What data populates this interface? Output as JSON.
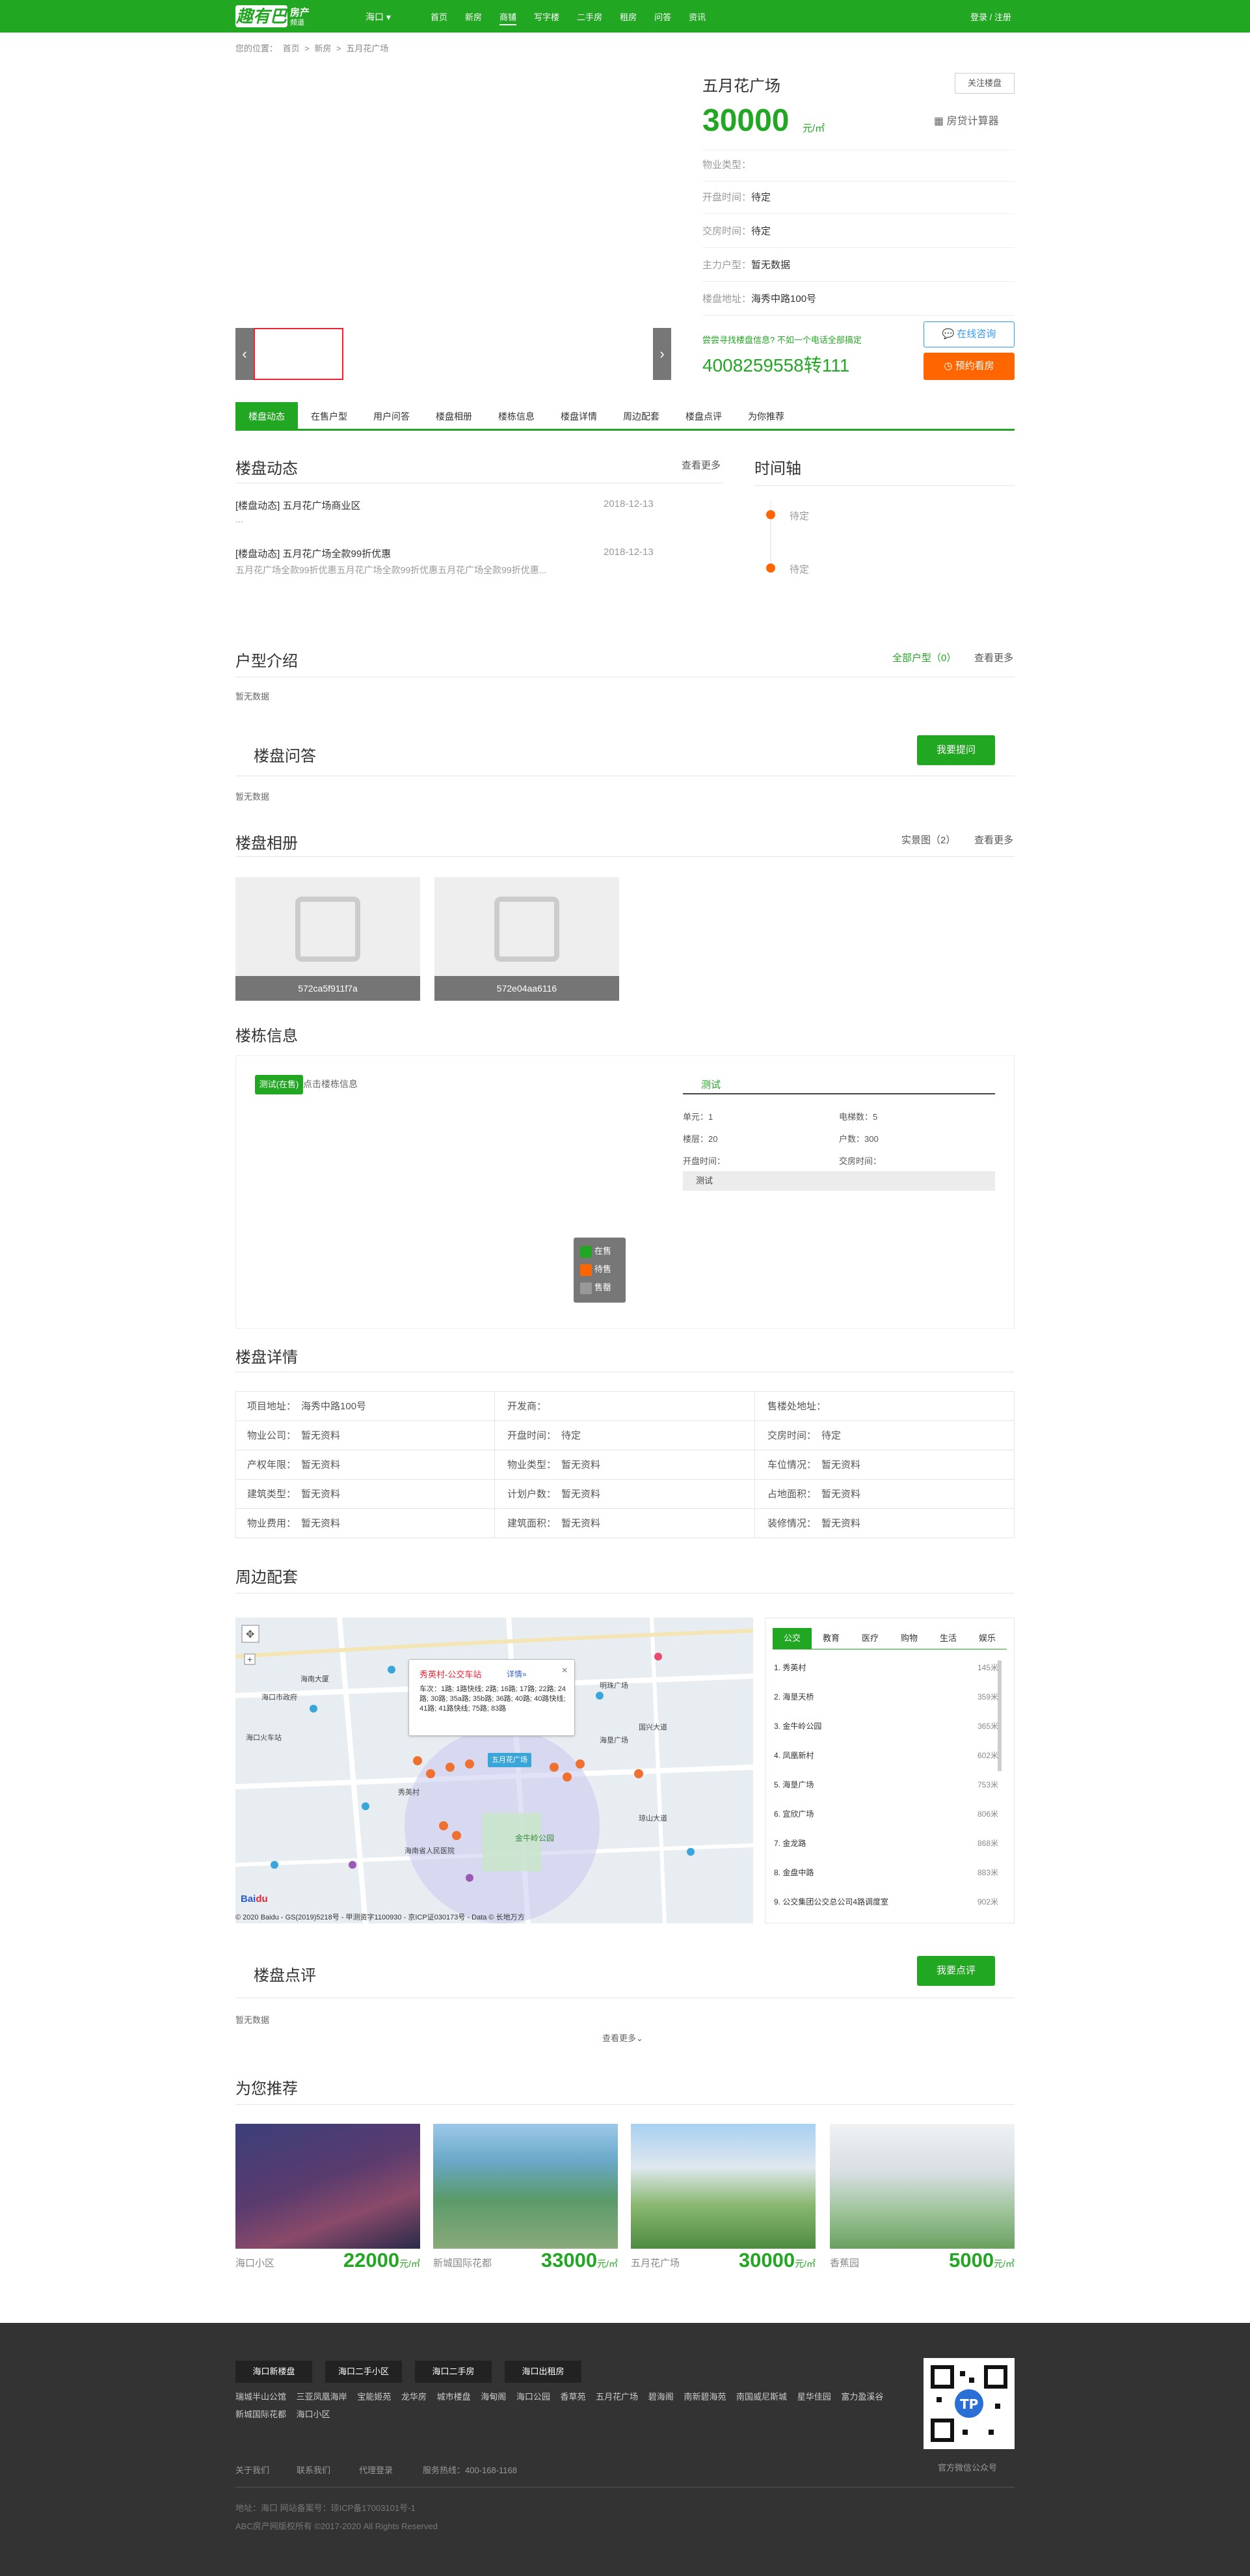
{
  "header": {
    "logo_mark": "趣有巴",
    "logo_line1": "房产",
    "logo_line2": "频道",
    "city": "海口 ▾",
    "nav": [
      "首页",
      "新房",
      "商铺",
      "写字楼",
      "二手房",
      "租房",
      "问答",
      "资讯"
    ],
    "active_nav": "商铺",
    "login": "登录 / 注册"
  },
  "breadcrumb": [
    "您的位置：",
    "首页",
    ">",
    "新房",
    ">",
    "五月花广场"
  ],
  "property": {
    "name": "五月花广场",
    "follow": "关注楼盘",
    "price": "30000",
    "price_unit": "元/㎡",
    "calculator": "房贷计算器",
    "rows": [
      {
        "k": "物业类型：",
        "v": ""
      },
      {
        "k": "开盘时间：",
        "v": "待定"
      },
      {
        "k": "交房时间：",
        "v": "待定"
      },
      {
        "k": "主力户型：",
        "v": "暂无数据"
      },
      {
        "k": "楼盘地址：",
        "v": "海秀中路100号"
      }
    ],
    "hotline_tip": "尝尝寻找楼盘信息? 不如一个电话全部搞定",
    "hotline": "4008259558转111",
    "consult": "在线咨询",
    "appointment": "预约看房"
  },
  "tabs": [
    "楼盘动态",
    "在售户型",
    "用户问答",
    "楼盘相册",
    "楼栋信息",
    "楼盘详情",
    "周边配套",
    "楼盘点评",
    "为你推荐"
  ],
  "dynamics": {
    "title": "楼盘动态",
    "more": "查看更多",
    "items": [
      {
        "title": "[楼盘动态] 五月花广场商业区",
        "date": "2018-12-13",
        "sub": "..."
      },
      {
        "title": "[楼盘动态] 五月花广场全款99折优惠",
        "date": "2018-12-13",
        "sub": "五月花广场全款99折优惠五月花广场全款99折优惠五月花广场全款99折优惠..."
      }
    ]
  },
  "timeline": {
    "title": "时间轴",
    "items": [
      "待定",
      "待定"
    ]
  },
  "units": {
    "title": "户型介绍",
    "all": "全部户型（0）",
    "more": "查看更多",
    "empty": "暂无数据"
  },
  "qa": {
    "title": "楼盘问答",
    "ask": "我要提问",
    "empty": "暂无数据"
  },
  "album": {
    "title": "楼盘相册",
    "real": "实景图（2）",
    "more": "查看更多",
    "photos": [
      "572ca5f911f7a",
      "572e04aa6116"
    ]
  },
  "building": {
    "title": "楼栋信息",
    "tag": "测试(在售)",
    "hint": "点击楼栋信息",
    "tab": "测试",
    "kv": [
      {
        "k": "单元：",
        "v": "1"
      },
      {
        "k": "电梯数：",
        "v": "5"
      },
      {
        "k": "楼层：",
        "v": "20"
      },
      {
        "k": "户数：",
        "v": "300"
      },
      {
        "k": "开盘时间：",
        "v": ""
      },
      {
        "k": "交房时间：",
        "v": ""
      }
    ],
    "bar": "测试",
    "legend": [
      {
        "label": "在售",
        "color": "#22a722"
      },
      {
        "label": "待售",
        "color": "#ff6600"
      },
      {
        "label": "售罄",
        "color": "#999999"
      }
    ]
  },
  "details": {
    "title": "楼盘详情",
    "cells": [
      {
        "k": "项目地址：",
        "v": "海秀中路100号"
      },
      {
        "k": "开发商：",
        "v": ""
      },
      {
        "k": "售楼处地址：",
        "v": ""
      },
      {
        "k": "物业公司：",
        "v": "暂无资料"
      },
      {
        "k": "开盘时间：",
        "v": "待定"
      },
      {
        "k": "交房时间：",
        "v": "待定"
      },
      {
        "k": "产权年限：",
        "v": "暂无资料"
      },
      {
        "k": "物业类型：",
        "v": "暂无资料"
      },
      {
        "k": "车位情况：",
        "v": "暂无资料"
      },
      {
        "k": "建筑类型：",
        "v": "暂无资料"
      },
      {
        "k": "计划户数：",
        "v": "暂无资料"
      },
      {
        "k": "占地面积：",
        "v": "暂无资料"
      },
      {
        "k": "物业费用：",
        "v": "暂无资料"
      },
      {
        "k": "建筑面积：",
        "v": "暂无资料"
      },
      {
        "k": "装修情况：",
        "v": "暂无资料"
      }
    ]
  },
  "surroundings": {
    "title": "周边配套",
    "tabs": [
      "公交",
      "教育",
      "医疗",
      "购物",
      "生活",
      "娱乐"
    ],
    "rows": [
      {
        "name": "1. 秀英村",
        "dist": "145米"
      },
      {
        "name": "2. 海垦天桥",
        "dist": "359米"
      },
      {
        "name": "3. 金牛岭公园",
        "dist": "365米"
      },
      {
        "name": "4. 凤凰新村",
        "dist": "602米"
      },
      {
        "name": "5. 海垦广场",
        "dist": "753米"
      },
      {
        "name": "6. 宜欣广场",
        "dist": "806米"
      },
      {
        "name": "7. 金龙路",
        "dist": "868米"
      },
      {
        "name": "8. 金盘中路",
        "dist": "883米"
      },
      {
        "name": "9. 公交集团公交总公司4路调度室",
        "dist": "902米"
      }
    ],
    "popup_title": "秀英村-公交车站",
    "popup_link": "详情»",
    "popup_desc": "车次：1路; 1路快线; 2路; 16路; 17路; 22路; 24路; 30路; 35a路; 35b路; 36路; 40路; 40路快线; 41路; 41路快线; 75路; 83路",
    "map_label": "五月花广场",
    "map_copyright": "© 2020 Baidu - GS(2019)5218号 - 甲测资字1100930 - 京ICP证030173号 - Data © 长地万方",
    "places": [
      "海口市政府",
      "海南大厦",
      "海垦广场",
      "明珠广场",
      "金牛岭公园",
      "海南省人民医院",
      "海口火车站",
      "国兴大道",
      "琼山大道",
      "秀英村"
    ]
  },
  "reviews": {
    "title": "楼盘点评",
    "btn": "我要点评",
    "empty": "暂无数据",
    "more": "查看更多⌄"
  },
  "recommend": {
    "title": "为您推荐",
    "items": [
      {
        "name": "海口小区",
        "price": "22000",
        "unit": "元/㎡"
      },
      {
        "name": "新城国际花都",
        "price": "33000",
        "unit": "元/㎡"
      },
      {
        "name": "五月花广场",
        "price": "30000",
        "unit": "元/㎡"
      },
      {
        "name": "香蕉园",
        "price": "5000",
        "unit": "元/㎡"
      }
    ]
  },
  "footer": {
    "buttons": [
      "海口新楼盘",
      "海口二手小区",
      "海口二手房",
      "海口出租房"
    ],
    "links": [
      "瑞城半山公馆",
      "三亚凤凰海岸",
      "宝能姬苑",
      "龙华房",
      "城市楼盘",
      "海甸阁",
      "海口公园",
      "香草苑",
      "五月花广场",
      "碧海阁",
      "南新碧海苑",
      "南国威尼斯城",
      "星华佳园",
      "富力盈溪谷",
      "新城国际花都",
      "海口小区"
    ],
    "bottom": [
      "关于我们",
      "联系我们",
      "代理登录",
      "服务热线：400-168-1168"
    ],
    "qr_label": "官方微信公众号",
    "meta1": "地址：海口 网站备案号：琼ICP备17003101号-1",
    "meta2": "ABC房产网版权所有 ©2017-2020 All Rights Reserved"
  },
  "colors": {
    "brand": "#22a722",
    "accent_orange": "#ff6600",
    "footer_bg": "#333333"
  }
}
